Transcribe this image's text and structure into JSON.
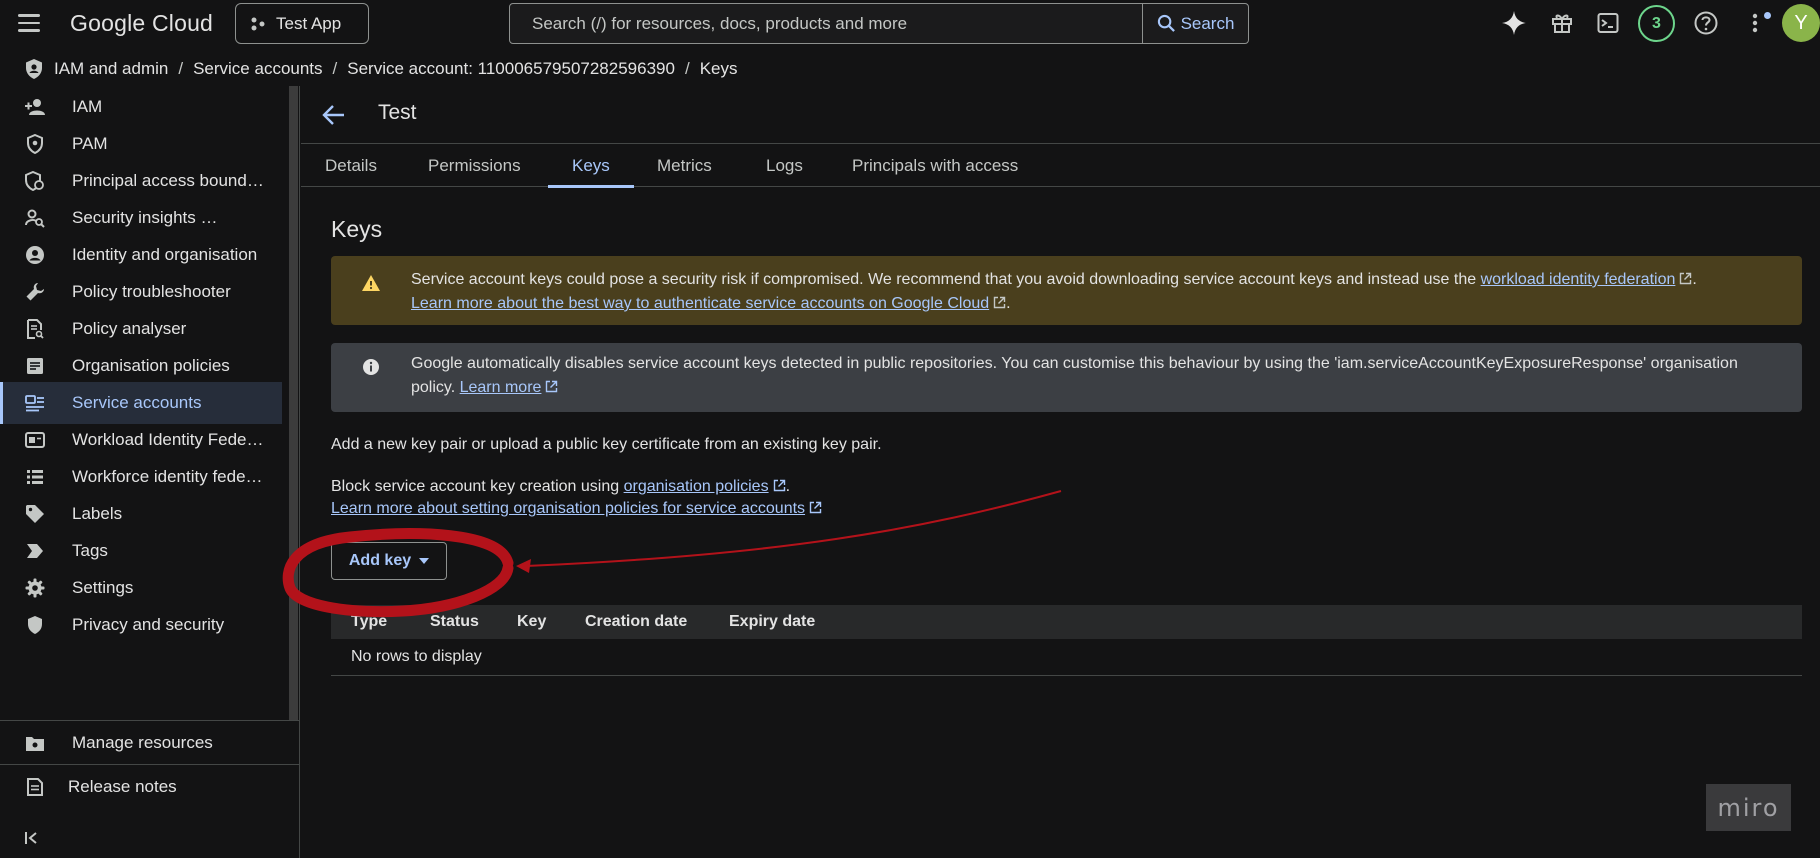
{
  "topbar": {
    "logo": "Google Cloud",
    "project": "Test App",
    "search_placeholder": "Search (/) for resources, docs, products and more",
    "search_button": "Search",
    "notifications_count": "3",
    "avatar_initial": "Y",
    "icons": [
      "menu-icon",
      "gemini-icon",
      "gift-icon",
      "terminal-icon",
      "help-icon",
      "more-icon"
    ]
  },
  "breadcrumb": {
    "items": [
      "IAM and admin",
      "Service accounts",
      "Service account: 110006579507282596390",
      "Keys"
    ]
  },
  "sidebar": {
    "items": [
      {
        "label": "IAM",
        "icon": "person-add-icon"
      },
      {
        "label": "PAM",
        "icon": "shield-icon"
      },
      {
        "label": "Principal access bound…",
        "icon": "shield-lock-icon"
      },
      {
        "label": "Security insights …",
        "icon": "person-search-icon"
      },
      {
        "label": "Identity and organisation",
        "icon": "account-circle-icon"
      },
      {
        "label": "Policy troubleshooter",
        "icon": "wrench-icon"
      },
      {
        "label": "Policy analyser",
        "icon": "document-search-icon"
      },
      {
        "label": "Organisation policies",
        "icon": "policy-doc-icon"
      },
      {
        "label": "Service accounts",
        "icon": "service-account-icon"
      },
      {
        "label": "Workload Identity Fede…",
        "icon": "badge-icon"
      },
      {
        "label": "Workforce identity fede…",
        "icon": "list-icon"
      },
      {
        "label": "Labels",
        "icon": "label-icon"
      },
      {
        "label": "Tags",
        "icon": "tag-icon"
      },
      {
        "label": "Settings",
        "icon": "gear-icon"
      },
      {
        "label": "Privacy and security",
        "icon": "privacy-icon"
      }
    ],
    "active_index": 8,
    "bottom": {
      "manage_resources": "Manage resources",
      "release_notes": "Release notes"
    }
  },
  "page": {
    "title": "Test",
    "tabs": [
      "Details",
      "Permissions",
      "Keys",
      "Metrics",
      "Logs",
      "Principals with access"
    ],
    "active_tab": "Keys",
    "section_title": "Keys",
    "warning": {
      "text": "Service account keys could pose a security risk if compromised. We recommend that you avoid downloading service account keys and instead use the ",
      "link1": "workload identity federation",
      "after_link1": ".",
      "link2": "Learn more about the best way to authenticate service accounts on Google Cloud",
      "after_link2": "."
    },
    "info": {
      "text": "Google automatically disables service account keys detected in public repositories. You can customise this behaviour by using the 'iam.serviceAccountKeyExposureResponse' organisation policy. ",
      "link": "Learn more"
    },
    "add_key_intro": "Add a new key pair or upload a public key certificate from an existing key pair.",
    "block_text": "Block service account key creation using ",
    "block_link": "organisation policies",
    "block_after": ".",
    "learn_more_policies": "Learn more about setting organisation policies for service accounts",
    "add_key_button": "Add key",
    "table": {
      "columns": [
        "Type",
        "Status",
        "Key",
        "Creation date",
        "Expiry date"
      ],
      "empty_text": "No rows to display"
    }
  },
  "watermark": "miro",
  "colors": {
    "accent": "#a8c7fa",
    "warning_bg": "#4a3f1d",
    "info_bg": "#3c3f44",
    "annotation": "#b3121a",
    "badge": "#6dd58c",
    "avatar": "#8ab44a"
  }
}
